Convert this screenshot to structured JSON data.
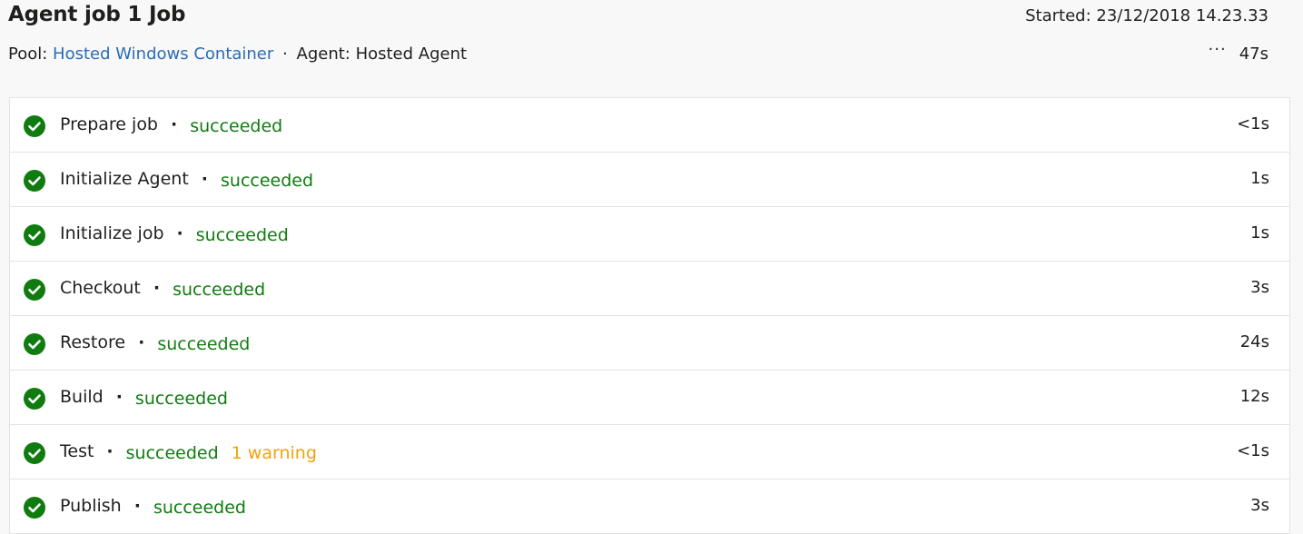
{
  "job": {
    "title": "Agent job 1 Job",
    "started": "Started: 23/12/2018 14.23.33",
    "pool_label": "Pool:",
    "pool_name": "Hosted Windows Container",
    "separator": "·",
    "agent_text": "Agent: Hosted Agent",
    "more_icon": "···",
    "total_duration": "47s"
  },
  "steps": [
    {
      "name": "Prepare job",
      "status": "succeeded",
      "warning": "",
      "duration": "<1s"
    },
    {
      "name": "Initialize Agent",
      "status": "succeeded",
      "warning": "",
      "duration": "1s"
    },
    {
      "name": "Initialize job",
      "status": "succeeded",
      "warning": "",
      "duration": "1s"
    },
    {
      "name": "Checkout",
      "status": "succeeded",
      "warning": "",
      "duration": "3s"
    },
    {
      "name": "Restore",
      "status": "succeeded",
      "warning": "",
      "duration": "24s"
    },
    {
      "name": "Build",
      "status": "succeeded",
      "warning": "",
      "duration": "12s"
    },
    {
      "name": "Test",
      "status": "succeeded",
      "warning": "1 warning",
      "duration": "<1s"
    },
    {
      "name": "Publish",
      "status": "succeeded",
      "warning": "",
      "duration": "3s"
    }
  ],
  "colors": {
    "success": "#107c10",
    "warning": "#f0a30a",
    "link": "#2b6cb5"
  },
  "icons": {
    "step_status": "check-circle-icon",
    "more": "more-options-icon"
  }
}
